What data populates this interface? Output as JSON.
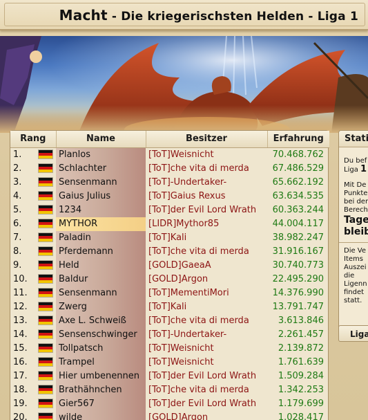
{
  "title": {
    "main": "Macht",
    "separator": "-",
    "sub": "Die kriegerischsten Helden - Liga 1"
  },
  "table": {
    "headers": {
      "rank": "Rang",
      "name": "Name",
      "owner": "Besitzer",
      "exp": "Erfahrung"
    },
    "flag_icon": "german-flag-icon",
    "rows": [
      {
        "rank": "1.",
        "name": "Planlos",
        "owner": "[ToT]Weisnicht",
        "exp": "70.468.762"
      },
      {
        "rank": "2.",
        "name": "Schlachter",
        "owner": "[ToT]che vita di merda",
        "exp": "67.486.529"
      },
      {
        "rank": "3.",
        "name": "Sensenmann",
        "owner": "[ToT]-Undertaker-",
        "exp": "65.662.192"
      },
      {
        "rank": "4.",
        "name": "Gaius Julius",
        "owner": "[ToT]Gaius Rexus",
        "exp": "63.634.535"
      },
      {
        "rank": "5.",
        "name": "1234",
        "owner": "[ToT]der Evil Lord Wrath",
        "exp": "60.363.244"
      },
      {
        "rank": "6.",
        "name": "MYTHOR",
        "owner": "[LIDR]Mythor85",
        "exp": "44.004.117",
        "highlight": true
      },
      {
        "rank": "7.",
        "name": "Paladin",
        "owner": "[ToT]Kali",
        "exp": "38.982.247"
      },
      {
        "rank": "8.",
        "name": "Pferdemann",
        "owner": "[ToT]che vita di merda",
        "exp": "31.916.167"
      },
      {
        "rank": "9.",
        "name": "Held",
        "owner": "[GOLD]GaeaA",
        "exp": "30.740.773"
      },
      {
        "rank": "10.",
        "name": "Baldur",
        "owner": "[GOLD]Argon",
        "exp": "22.495.290"
      },
      {
        "rank": "11.",
        "name": "Sensenmann",
        "owner": "[ToT]MementiMori",
        "exp": "14.376.990"
      },
      {
        "rank": "12.",
        "name": "Zwerg",
        "owner": "[ToT]Kali",
        "exp": "13.791.747"
      },
      {
        "rank": "13.",
        "name": "Axe L. Schweiß",
        "owner": "[ToT]che vita di merda",
        "exp": "3.613.846"
      },
      {
        "rank": "14.",
        "name": "Sensenschwinger",
        "owner": "[ToT]-Undertaker-",
        "exp": "2.261.457"
      },
      {
        "rank": "15.",
        "name": "Tollpatsch",
        "owner": "[ToT]Weisnicht",
        "exp": "2.139.872"
      },
      {
        "rank": "16.",
        "name": "Trampel",
        "owner": "[ToT]Weisnicht",
        "exp": "1.761.639"
      },
      {
        "rank": "17.",
        "name": "Hier umbenennen",
        "owner": "[ToT]der Evil Lord Wrath",
        "exp": "1.509.284"
      },
      {
        "rank": "18.",
        "name": "Brathähnchen",
        "owner": "[ToT]che vita di merda",
        "exp": "1.342.253"
      },
      {
        "rank": "19.",
        "name": "Gier567",
        "owner": "[ToT]der Evil Lord Wrath",
        "exp": "1.179.699"
      },
      {
        "rank": "20.",
        "name": "wilde",
        "owner": "[GOLD]Argon",
        "exp": "1.028.417"
      }
    ]
  },
  "side_panel": {
    "heading": "Stati",
    "line1": "Du bef",
    "line2_label": "Liga",
    "line2_value": "1",
    "block2": [
      "Mit De",
      "Punkte",
      "bei der",
      "Berech"
    ],
    "big1": "Tage",
    "big2": "bleib",
    "block3": [
      "Die Ve",
      "Items",
      "Auszei",
      "die",
      "Ligenn",
      "findet",
      "statt."
    ],
    "tab_label": "Liga"
  },
  "colors": {
    "owner_text": "#8c1414",
    "exp_text": "#1f7a14",
    "highlight_row": "#f4cf86",
    "parchment": "#e4d3ad"
  }
}
